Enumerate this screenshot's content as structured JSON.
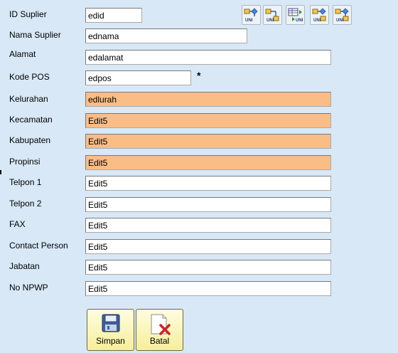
{
  "form": {
    "fields": [
      {
        "label": "ID Suplier",
        "value": "edid"
      },
      {
        "label": "Nama Suplier",
        "value": "ednama"
      },
      {
        "label": "Alamat",
        "value": "edalamat"
      },
      {
        "label": "Kode POS",
        "value": "edpos"
      },
      {
        "label": "Kelurahan",
        "value": "edlurah"
      },
      {
        "label": "Kecamatan",
        "value": "Edit5"
      },
      {
        "label": "Kabupaten",
        "value": "Edit5"
      },
      {
        "label": "Propinsi",
        "value": "Edit5"
      },
      {
        "label": "Telpon 1",
        "value": "Edit5"
      },
      {
        "label": "Telpon 2",
        "value": "Edit5"
      },
      {
        "label": "FAX",
        "value": "Edit5"
      },
      {
        "label": "Contact Person",
        "value": "Edit5"
      },
      {
        "label": "Jabatan",
        "value": "Edit5"
      },
      {
        "label": "No NPWP",
        "value": "Edit5"
      }
    ],
    "required_mark": "*",
    "highlight_color": "#fbbd86"
  },
  "toolbar": {
    "icons": [
      "db-link-uni-icon",
      "db-link-uni-icon",
      "db-grid-transfer-icon",
      "db-link-uni-icon",
      "db-link-uni-icon"
    ],
    "icon_text": "UNI"
  },
  "actions": {
    "save_label": "Simpan",
    "cancel_label": "Batal"
  }
}
